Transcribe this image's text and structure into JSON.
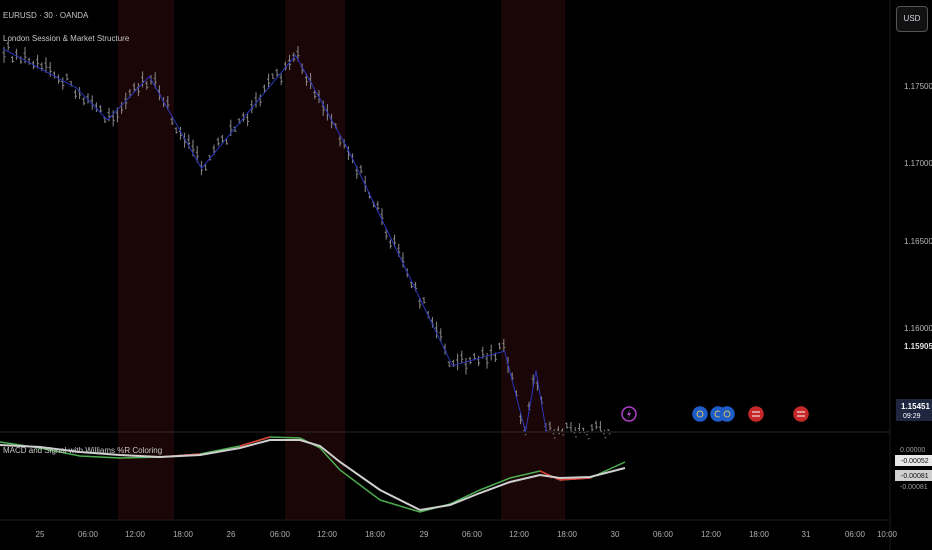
{
  "header": {
    "symbol_line": "EURUSD · 30 · OANDA",
    "indicator_name": "London Session & Market Structure",
    "currency_button": "USD"
  },
  "price_axis": {
    "labels": [
      "1.17500",
      "1.17000",
      "1.16500",
      "1.16000"
    ],
    "prev_close_label": "1.15905",
    "last_price_label": "1.15451",
    "countdown": "09:29"
  },
  "macd_pane": {
    "title": "MACD and Signal with Williams %R Coloring",
    "axis_labels": [
      "0.00000",
      "-0.00081"
    ],
    "value_label_1": "-0.00052",
    "value_label_2": "-0.00081"
  },
  "time_axis": {
    "labels": [
      "25",
      "06:00",
      "12:00",
      "18:00",
      "26",
      "06:00",
      "12:00",
      "18:00",
      "29",
      "06:00",
      "12:00",
      "18:00",
      "30",
      "06:00",
      "12:00",
      "18:00",
      "31",
      "06:00",
      "10:00"
    ]
  },
  "colors": {
    "background": "#000000",
    "bar": "#8a8a8a",
    "structure_line": "#2a34b8",
    "session_shade": "#1a0606",
    "macd_green": "#4caf50",
    "macd_red": "#e53935",
    "signal_white": "#cfcfcf",
    "event_flash": "#b040c8",
    "event_eu": "#1e5cc8",
    "event_us": "#c62828"
  },
  "events": [
    {
      "type": "flash-icon"
    },
    {
      "type": "eu-flag-icon"
    },
    {
      "type": "eu-flag-icon"
    },
    {
      "type": "eu-flag-icon"
    },
    {
      "type": "us-flag-icon"
    },
    {
      "type": "us-flag-icon"
    }
  ],
  "chart_data": {
    "type": "line",
    "title": "EURUSD · 30 · OANDA",
    "ylim": [
      1.1545,
      1.1785
    ],
    "market_structure": [
      {
        "t": 0,
        "y": 1.1782
      },
      {
        "t": 7,
        "y": 1.1758
      },
      {
        "t": 10,
        "y": 1.1738
      },
      {
        "t": 14,
        "y": 1.1765
      },
      {
        "t": 19,
        "y": 1.1708
      },
      {
        "t": 28,
        "y": 1.1778
      },
      {
        "t": 33,
        "y": 1.172
      },
      {
        "t": 43,
        "y": 1.1586
      },
      {
        "t": 48,
        "y": 1.1595
      },
      {
        "t": 50,
        "y": 1.1545
      },
      {
        "t": 51,
        "y": 1.1583
      },
      {
        "t": 52,
        "y": 1.1545
      }
    ],
    "last_price": 1.15451,
    "prev_close": 1.15905
  }
}
